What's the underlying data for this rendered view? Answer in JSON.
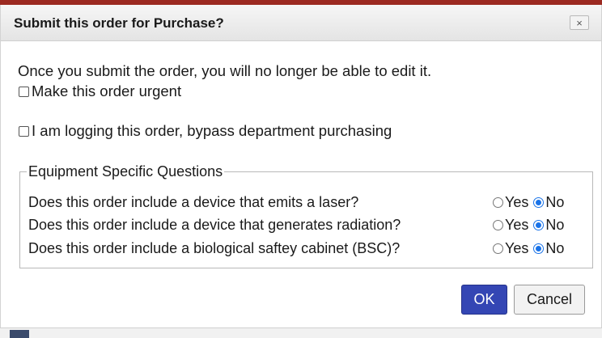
{
  "dialog": {
    "title": "Submit this order for Purchase?",
    "close_label": "×",
    "message": "Once you submit the order, you will no longer be able to edit it.",
    "options": [
      {
        "label": "Make this order urgent",
        "checked": false
      },
      {
        "label": "I am logging this order, bypass department purchasing",
        "checked": false
      }
    ],
    "equipment": {
      "legend": "Equipment Specific Questions",
      "yes_label": "Yes",
      "no_label": "No",
      "questions": [
        {
          "text": "Does this order include a device that emits a laser?",
          "answer": "No"
        },
        {
          "text": "Does this order include a device that generates radiation?",
          "answer": "No"
        },
        {
          "text": "Does this order include a biological saftey cabinet (BSC)?",
          "answer": "No"
        }
      ]
    },
    "ok_label": "OK",
    "cancel_label": "Cancel"
  },
  "colors": {
    "ok_button": "#3446b4",
    "radio_selected": "#1a73e8",
    "top_rule": "#9c2a21"
  }
}
